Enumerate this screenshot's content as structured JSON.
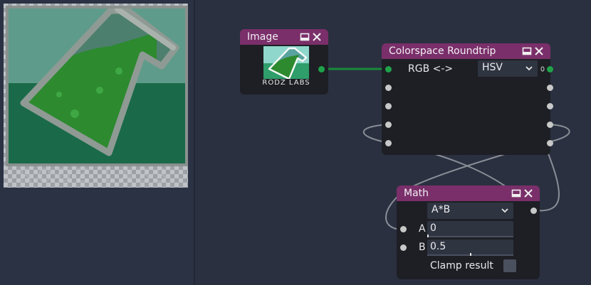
{
  "colors": {
    "node_header": "#7a2f6a",
    "node_body": "#1d1f24",
    "graph_background": "#2a3040",
    "wire_green": "#1a8a3c",
    "wire_gray": "#8a8e96"
  },
  "preview": {
    "brand_text": "RODZ LABS",
    "logo_icon": "flask-icon"
  },
  "nodes": {
    "image": {
      "title": "Image",
      "thumb_text": "RODZ LABS"
    },
    "colorspace": {
      "title": "Colorspace Roundtrip",
      "label": "RGB <->",
      "mode_value": "HSV"
    },
    "math": {
      "title": "Math",
      "operation_value": "A*B",
      "a_label": "A",
      "a_value": "0",
      "a_level": 0,
      "b_label": "B",
      "b_value": "0.5",
      "b_level": 0.5,
      "clamp_label": "Clamp result",
      "clamp_checked": false
    }
  }
}
